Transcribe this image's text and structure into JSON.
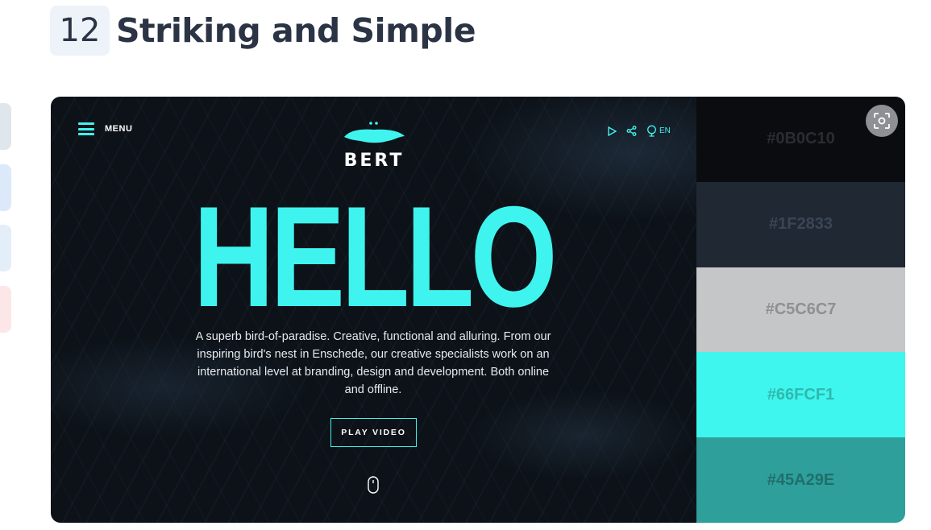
{
  "heading": {
    "number": "12",
    "title": "Striking and Simple"
  },
  "hero": {
    "menu_label": "MENU",
    "logo_text": "BERT",
    "language": "EN",
    "headline": "HELLO",
    "description": "A superb bird-of-paradise. Creative, functional and alluring. From our inspiring bird's nest in Enschede, our creative specialists work on an international level at branding, design and development. Both online and offline.",
    "play_button": "PLAY VIDEO",
    "accent_color": "#3ff4ee"
  },
  "palette": [
    {
      "hex": "#0B0C10",
      "color": "#0b0c10"
    },
    {
      "hex": "#1F2833",
      "color": "#1f2833"
    },
    {
      "hex": "#C5C6C7",
      "color": "#c5c6c7"
    },
    {
      "hex": "#66FCF1",
      "color": "#66fcf1"
    },
    {
      "hex": "#45A29E",
      "color": "#45a29e"
    }
  ],
  "icons": {
    "menu": "hamburger-icon",
    "play": "play-icon",
    "share": "share-icon",
    "globe": "globe-icon",
    "scroll": "mouse-scroll-icon",
    "scan": "scan-icon"
  }
}
